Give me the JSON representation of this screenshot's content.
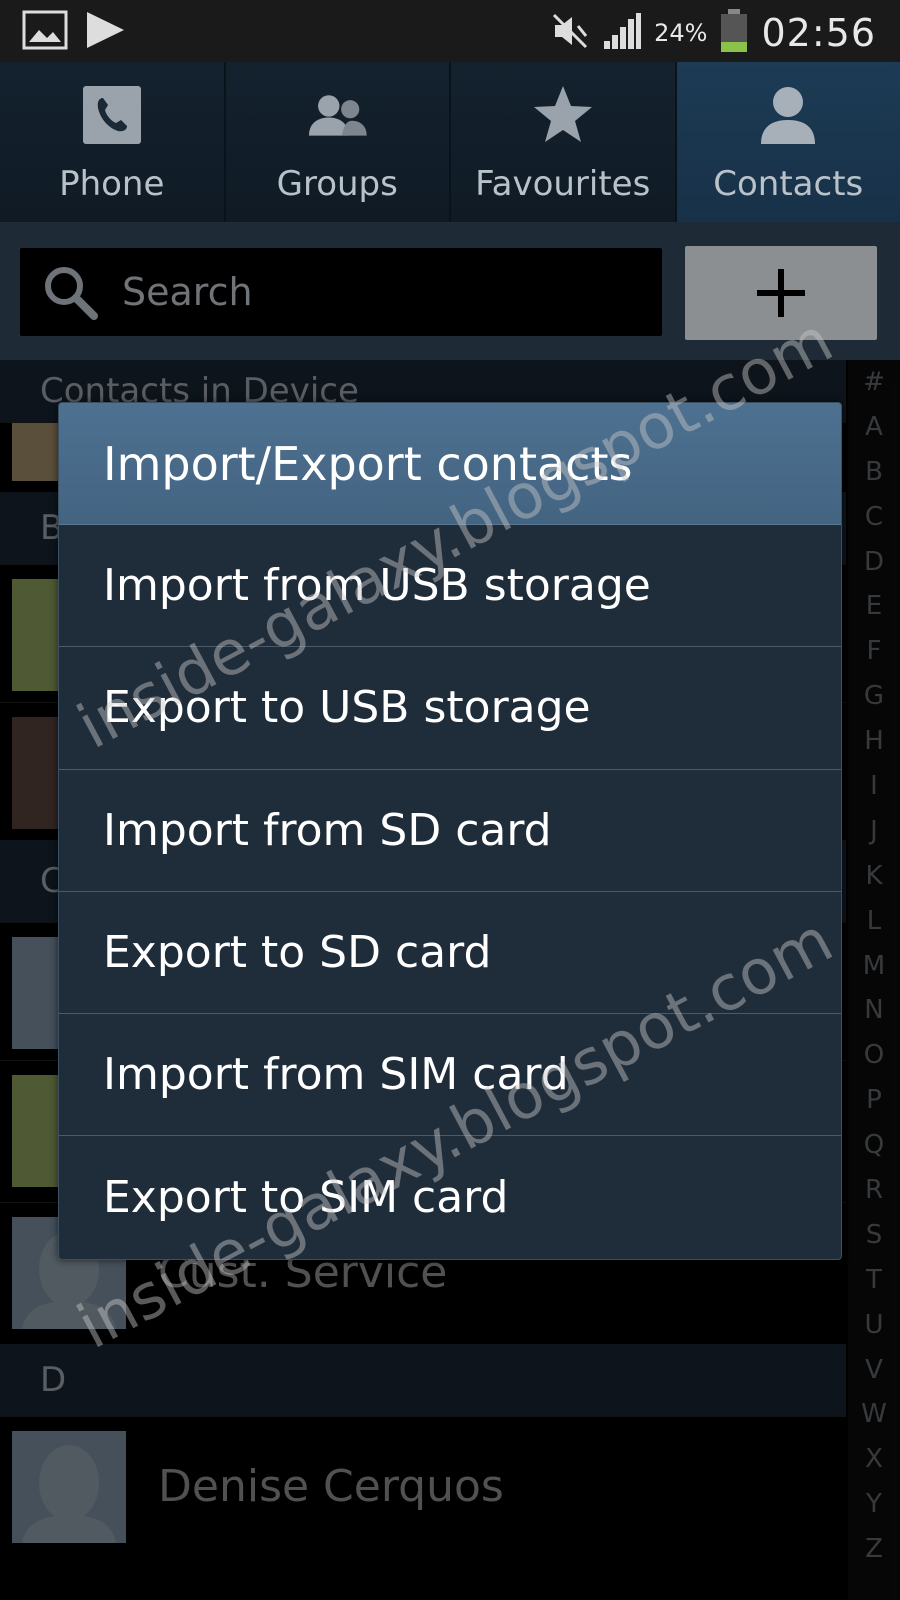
{
  "status_bar": {
    "battery_percent": "24%",
    "time": "02:56",
    "icons": [
      "gallery-icon",
      "play-store-icon",
      "mute-icon",
      "signal-icon",
      "battery-icon"
    ]
  },
  "tabs": [
    {
      "label": "Phone",
      "icon": "phone-icon",
      "active": false
    },
    {
      "label": "Groups",
      "icon": "groups-icon",
      "active": false
    },
    {
      "label": "Favourites",
      "icon": "star-icon",
      "active": false
    },
    {
      "label": "Contacts",
      "icon": "contact-icon",
      "active": true
    }
  ],
  "search": {
    "placeholder": "Search",
    "add_button_icon": "plus-icon"
  },
  "list": {
    "section_device": "Contacts in Device",
    "section_b": "B",
    "section_c": "C",
    "section_d": "D",
    "contacts": [
      "Cust. Service",
      "Denise Cerquos"
    ]
  },
  "alphabet": [
    "#",
    "A",
    "B",
    "C",
    "D",
    "E",
    "F",
    "G",
    "H",
    "I",
    "J",
    "K",
    "L",
    "M",
    "N",
    "O",
    "P",
    "Q",
    "R",
    "S",
    "T",
    "U",
    "V",
    "W",
    "X",
    "Y",
    "Z"
  ],
  "dialog": {
    "title": "Import/Export contacts",
    "items": [
      "Import from USB storage",
      "Export to USB storage",
      "Import from SD card",
      "Export to SD card",
      "Import from SIM card",
      "Export to SIM card"
    ]
  },
  "watermark": "inside-galaxy.blogspot.com"
}
